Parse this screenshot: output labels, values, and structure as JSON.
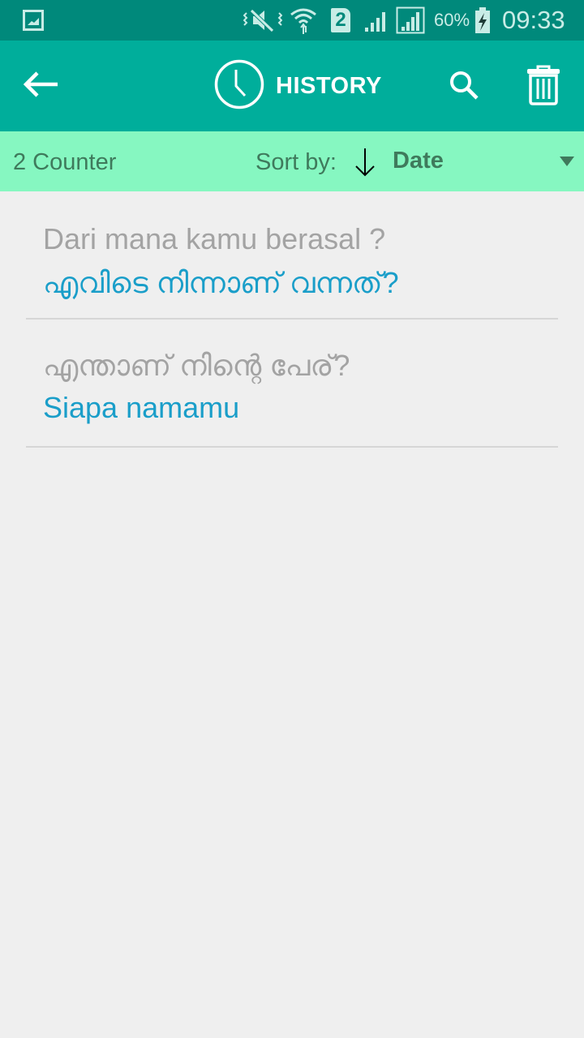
{
  "status_bar": {
    "icons": [
      "gallery-icon",
      "mute-vibrate-icon",
      "wifi-icon",
      "sim-2-icon",
      "signal-icon",
      "signal-icon"
    ],
    "sim_label": "2",
    "battery_percent": "60%",
    "time": "09:33"
  },
  "app_bar": {
    "title": "HISTORY",
    "back_icon": "arrow-left-icon",
    "title_icon": "clock-icon",
    "search_icon": "search-icon",
    "delete_icon": "trash-icon"
  },
  "sort_bar": {
    "counter": "2 Counter",
    "sort_label": "Sort by:",
    "sort_direction": "descending",
    "sort_value": "Date"
  },
  "history": [
    {
      "source": "Dari mana kamu berasal ?",
      "translation": "എവിടെ നിന്നാണ് വന്നത്?"
    },
    {
      "source": "എന്താണ് നിന്റെ പേര്?",
      "translation": "Siapa namamu"
    }
  ],
  "colors": {
    "status_bar": "#00897b",
    "app_bar": "#00ae9b",
    "sort_bar": "#86f7c1",
    "source_text": "#a3a3a3",
    "translation_text": "#1a9ec9"
  }
}
